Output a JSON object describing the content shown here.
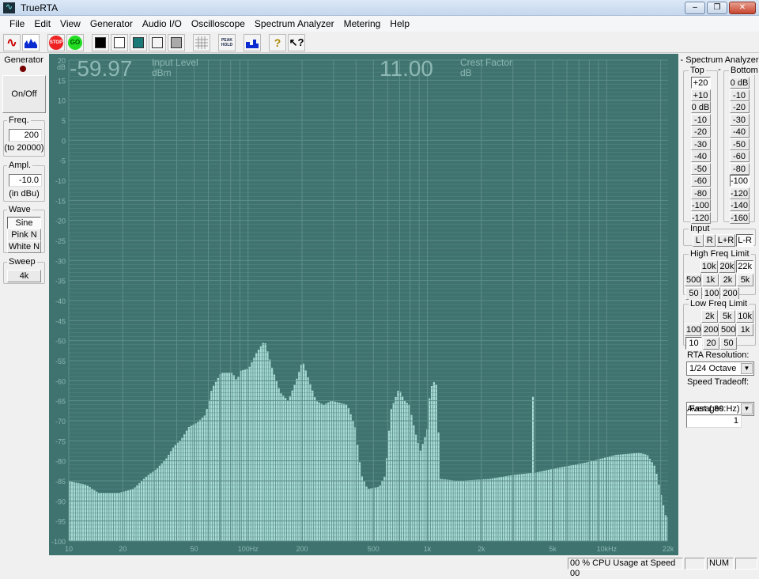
{
  "window": {
    "title": "TrueRTA",
    "controls": [
      "–",
      "❐",
      "✕"
    ]
  },
  "menu": [
    "File",
    "Edit",
    "View",
    "Generator",
    "Audio I/O",
    "Oscilloscope",
    "Spectrum Analyzer",
    "Metering",
    "Help"
  ],
  "toolbar": {
    "icons": [
      "oscilloscope-icon",
      "spectrum-icon",
      "stop-icon",
      "go-icon",
      "black-bg-icon",
      "white-bg-icon",
      "teal-bg-icon",
      "light-bg-icon",
      "gray-bg-icon",
      "grid-icon",
      "peak-hold-icon",
      "bar-mode-icon",
      "help-icon",
      "context-help-icon"
    ],
    "stop": "STOP",
    "go": "GO",
    "peak": "PEAK HOLD",
    "help": "?",
    "ctxhelp": "?"
  },
  "generator": {
    "title": "Generator",
    "onoff": "On/Off",
    "freq_label": "Freq.",
    "freq_value": "200",
    "freq_range": "(to 20000)",
    "ampl_label": "Ampl.",
    "ampl_value": "-10.0",
    "ampl_unit": "(in dBu)",
    "wave_label": "Wave",
    "waves": [
      "Sine",
      "Pink N",
      "White N"
    ],
    "wave_selected": "Sine",
    "sweep_label": "Sweep",
    "sweep_value": "4k"
  },
  "readouts": {
    "input_level": "-59.97",
    "input_label": "Input Level",
    "input_unit": "dBm",
    "crest": "11.00",
    "crest_label": "Crest Factor",
    "crest_unit": "dB"
  },
  "analyzer": {
    "title": "- Spectrum Analyzer -",
    "top_label": "Top",
    "top": [
      "+20",
      "+10",
      "0 dB",
      "-10",
      "-20",
      "-30",
      "-40",
      "-50",
      "-60",
      "-80",
      "-100",
      "-120"
    ],
    "top_selected": "+20",
    "bottom_label": "Bottom",
    "bottom": [
      "0 dB",
      "-10",
      "-20",
      "-30",
      "-40",
      "-50",
      "-60",
      "-80",
      "-100",
      "-120",
      "-140",
      "-160"
    ],
    "bottom_selected": "-100",
    "input_label": "Input",
    "inputs": [
      "L",
      "R",
      "L+R",
      "L-R"
    ],
    "input_selected": "L-R",
    "hf_label": "High Freq Limit",
    "hf_rows": [
      [
        "10k",
        "20k",
        "22k"
      ],
      [
        "500",
        "1k",
        "2k",
        "5k"
      ],
      [
        "50",
        "100",
        "200"
      ]
    ],
    "hf_selected": "22k",
    "lf_label": "Low Freq Limit",
    "lf_rows": [
      [
        "2k",
        "5k",
        "10k"
      ],
      [
        "100",
        "200",
        "500",
        "1k"
      ],
      [
        "10",
        "20",
        "50"
      ]
    ],
    "lf_selected": "10",
    "res_label": "RTA Resolution:",
    "res_value": "1/24 Octave",
    "speed_label": "Speed Tradeoff:",
    "speed_value": "Fast ( 80 Hz)",
    "avg_label": "Averages:",
    "avg_value": "1"
  },
  "status": {
    "cpu": "00 % CPU Usage at Speed 00",
    "num": "NUM"
  },
  "colors": {
    "plot_bg": "#3f736f",
    "bars": "#a9dcd6",
    "grid": "#5e8d89",
    "text": "#8db8b4"
  },
  "chart_data": {
    "type": "bar",
    "resolution": "1/24 Octave",
    "x_scale": "log",
    "xlim": [
      10,
      22000
    ],
    "ylim": [
      -100,
      20
    ],
    "yunit": "dB",
    "grid": true,
    "x_ticks": [
      {
        "v": 10,
        "l": "10"
      },
      {
        "v": 20,
        "l": "20"
      },
      {
        "v": 50,
        "l": "50"
      },
      {
        "v": 100,
        "l": "100Hz"
      },
      {
        "v": 200,
        "l": "200"
      },
      {
        "v": 500,
        "l": "500"
      },
      {
        "v": 1000,
        "l": "1k"
      },
      {
        "v": 2000,
        "l": "2k"
      },
      {
        "v": 5000,
        "l": "5k"
      },
      {
        "v": 10000,
        "l": "10kHz"
      },
      {
        "v": 22000,
        "l": "22k"
      }
    ],
    "y_ticks": [
      20,
      15,
      10,
      5,
      0,
      -5,
      -10,
      -15,
      -20,
      -25,
      -30,
      -35,
      -40,
      -45,
      -50,
      -55,
      -60,
      -65,
      -70,
      -75,
      -80,
      -85,
      -90,
      -95,
      -100
    ],
    "spectrum": [
      [
        10,
        -85
      ],
      [
        12.6,
        -86
      ],
      [
        14.7,
        -88
      ],
      [
        19,
        -88
      ],
      [
        23,
        -87
      ],
      [
        27,
        -84
      ],
      [
        31,
        -82
      ],
      [
        35,
        -79.5
      ],
      [
        38.5,
        -76.5
      ],
      [
        42.7,
        -74.5
      ],
      [
        47,
        -71.5
      ],
      [
        52,
        -70.5
      ],
      [
        58,
        -68.5
      ],
      [
        63,
        -62
      ],
      [
        71,
        -58
      ],
      [
        82,
        -58
      ],
      [
        87,
        -60
      ],
      [
        91,
        -57.5
      ],
      [
        101,
        -57
      ],
      [
        112,
        -53
      ],
      [
        124,
        -50
      ],
      [
        137,
        -57
      ],
      [
        152,
        -63
      ],
      [
        168,
        -65
      ],
      [
        186,
        -60
      ],
      [
        202,
        -55
      ],
      [
        216,
        -59
      ],
      [
        240,
        -65
      ],
      [
        265,
        -66
      ],
      [
        293,
        -65
      ],
      [
        359,
        -66
      ],
      [
        397,
        -71.5
      ],
      [
        430,
        -83.5
      ],
      [
        465,
        -87
      ],
      [
        541,
        -86.5
      ],
      [
        585,
        -83.5
      ],
      [
        626,
        -67.5
      ],
      [
        695,
        -62
      ],
      [
        748,
        -65
      ],
      [
        795,
        -66
      ],
      [
        855,
        -72.5
      ],
      [
        917,
        -77.5
      ],
      [
        1000,
        -72.5
      ],
      [
        1040,
        -62
      ],
      [
        1120,
        -59.5
      ],
      [
        1190,
        -84.5
      ],
      [
        1490,
        -85
      ],
      [
        2230,
        -84.5
      ],
      [
        3030,
        -83.5
      ],
      [
        3850,
        -83
      ],
      [
        3900,
        -64
      ],
      [
        3950,
        -83
      ],
      [
        5000,
        -82
      ],
      [
        7530,
        -80.5
      ],
      [
        11300,
        -78.5
      ],
      [
        15300,
        -78
      ],
      [
        16900,
        -78.5
      ],
      [
        18700,
        -81.5
      ],
      [
        20400,
        -89.5
      ],
      [
        21500,
        -94
      ]
    ]
  }
}
